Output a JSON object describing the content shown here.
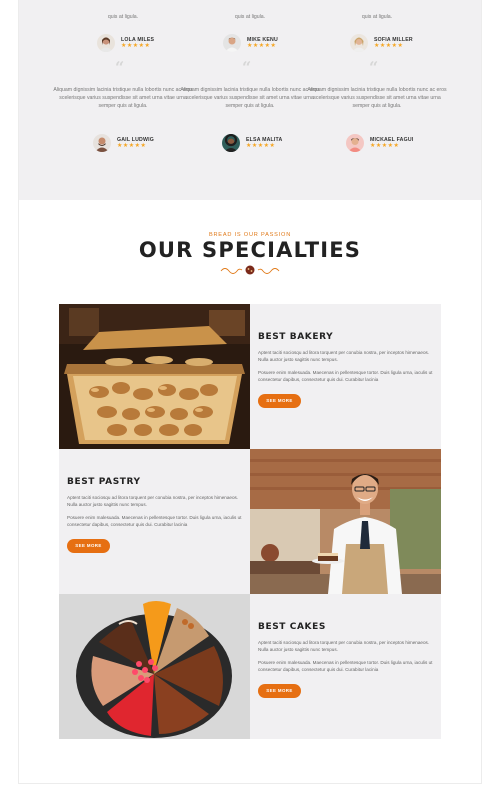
{
  "testimonials": {
    "top_row_tail": [
      "quis at ligula.",
      "quis at ligula.",
      "quis at ligula."
    ],
    "top_reviewers": [
      {
        "name": "LOLA MILES",
        "stars": "★★★★★"
      },
      {
        "name": "MIKE KENU",
        "stars": "★★★★★"
      },
      {
        "name": "SOFIA MILLER",
        "stars": "★★★★★"
      }
    ],
    "bottom_items": [
      {
        "quote_mark": "“",
        "text": "Aliquam dignissim lacinia tristique nulla lobortis nunc ac eros scelerisque varius suspendisse sit amet urna vitae urna semper quis at ligula.",
        "name": "GAIL LUDWIG",
        "stars": "★★★★★"
      },
      {
        "quote_mark": "“",
        "text": "Aliquam dignissim lacinia tristique nulla lobortis nunc ac eros scelerisque varius suspendisse sit amet urna vitae urna semper quis at ligula.",
        "name": "ELSA MALITA",
        "stars": "★★★★★"
      },
      {
        "quote_mark": "“",
        "text": "Aliquam dignissim lacinia tristique nulla lobortis nunc ac eros scelerisque varius suspendisse sit amet urna vitae urna semper quis at ligula.",
        "name": "MICKAEL FAGUI",
        "stars": "★★★★★"
      }
    ]
  },
  "specialties": {
    "eyebrow": "BREAD IS OUR PASSION",
    "title": "OUR SPECIALTIES",
    "items": [
      {
        "title": "BEST BAKERY",
        "p1": "Aptent taciti sociosqu ad litora torquent per conubia nostra, per inceptos himenaeos. Nulla auctor justo sagittis nunc tempus.",
        "p2": "Posuere enim malesuada. Maecenas in pellentesque tortor. Duis ligula urna, iaculis ut consectetur dapibus, consectetur quis dui. Curabitur lacinia",
        "button": "SEE MORE"
      },
      {
        "title": "BEST PASTRY",
        "p1": "Aptent taciti sociosqu ad litora torquent per conubia nostra, per inceptos himenaeos. Nulla auctor justo sagittis nunc tempus.",
        "p2": "Posuere enim malesuada. Maecenas in pellentesque tortor. Duis ligula urna, iaculis ut consectetur dapibus, consectetur quis dui. Curabitur lacinia",
        "button": "SEE MORE"
      },
      {
        "title": "BEST CAKES",
        "p1": "Aptent taciti sociosqu ad litora torquent per conubia nostra, per inceptos himenaeos. Nulla auctor justo sagittis nunc tempus.",
        "p2": "Posuere enim malesuada. Maecenas in pellentesque tortor. Duis ligula urna, iaculis ut consectetur dapibus, consectetur quis dui. Curabitur lacinia",
        "button": "SEE MORE"
      }
    ]
  },
  "colors": {
    "accent": "#e66f12",
    "eyebrow": "#e07a1a",
    "star": "#f5a623",
    "panel_bg": "#f1f0f2"
  },
  "icons": [
    "quote-icon",
    "star-icon",
    "ornament-icon"
  ]
}
